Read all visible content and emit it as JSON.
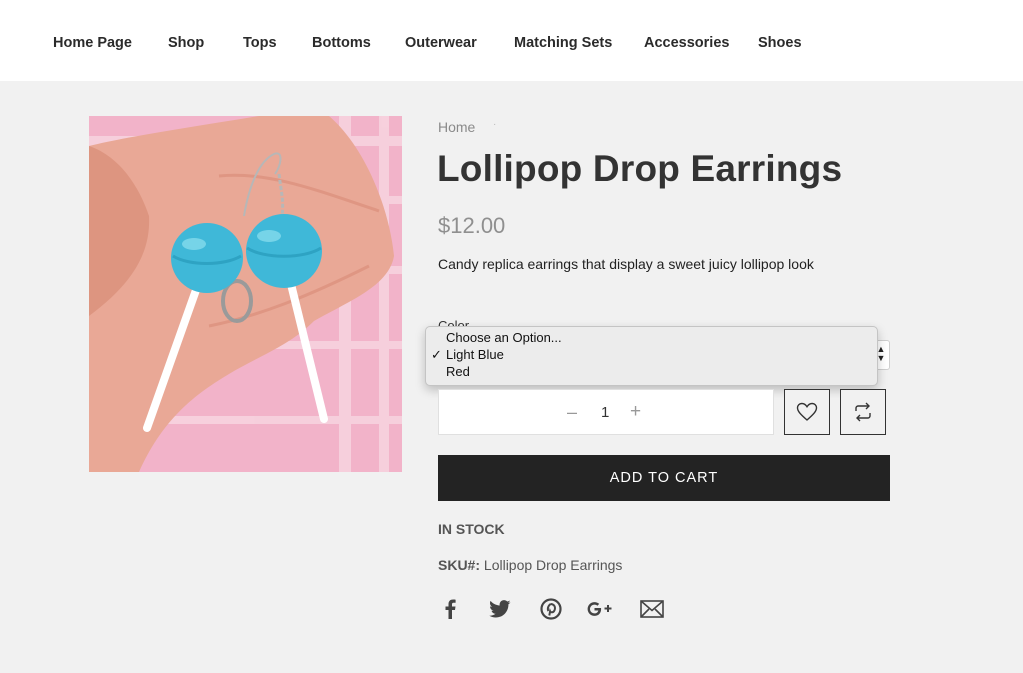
{
  "nav": {
    "items": [
      {
        "label": "Home Page"
      },
      {
        "label": "Shop"
      },
      {
        "label": "Tops"
      },
      {
        "label": "Bottoms"
      },
      {
        "label": "Outerwear"
      },
      {
        "label": "Matching Sets"
      },
      {
        "label": "Accessories"
      },
      {
        "label": "Shoes"
      }
    ]
  },
  "breadcrumb": {
    "home": "Home",
    "separator": "·"
  },
  "product": {
    "title": "Lollipop Drop Earrings",
    "price": "$12.00",
    "description": "Candy replica earrings that display a sweet juicy lollipop look",
    "image_icon": "product-photo",
    "image_colors": {
      "candy": "#3fb8d8",
      "background": "#f2b3c9",
      "skin": "#e9a896"
    }
  },
  "options": {
    "color_label": "Color",
    "choices": [
      "Choose an Option...",
      "Light Blue",
      "Red"
    ],
    "selected": "Light Blue",
    "check_mark": "✓"
  },
  "quantity": {
    "value": "1",
    "minus": "–",
    "plus": "+"
  },
  "actions": {
    "wishlist_icon": "heart-icon",
    "compare_icon": "compare-icon",
    "add_to_cart": "ADD TO CART"
  },
  "stock": {
    "status": "IN STOCK"
  },
  "sku": {
    "label": "SKU#:",
    "value": "Lollipop Drop Earrings"
  },
  "share": {
    "icons": [
      "facebook-icon",
      "twitter-icon",
      "pinterest-icon",
      "google-plus-icon",
      "email-icon"
    ]
  },
  "colors": {
    "accent_dark": "#232323",
    "page_bg": "#f1f1f1",
    "price_gray": "#8f8f8f"
  }
}
